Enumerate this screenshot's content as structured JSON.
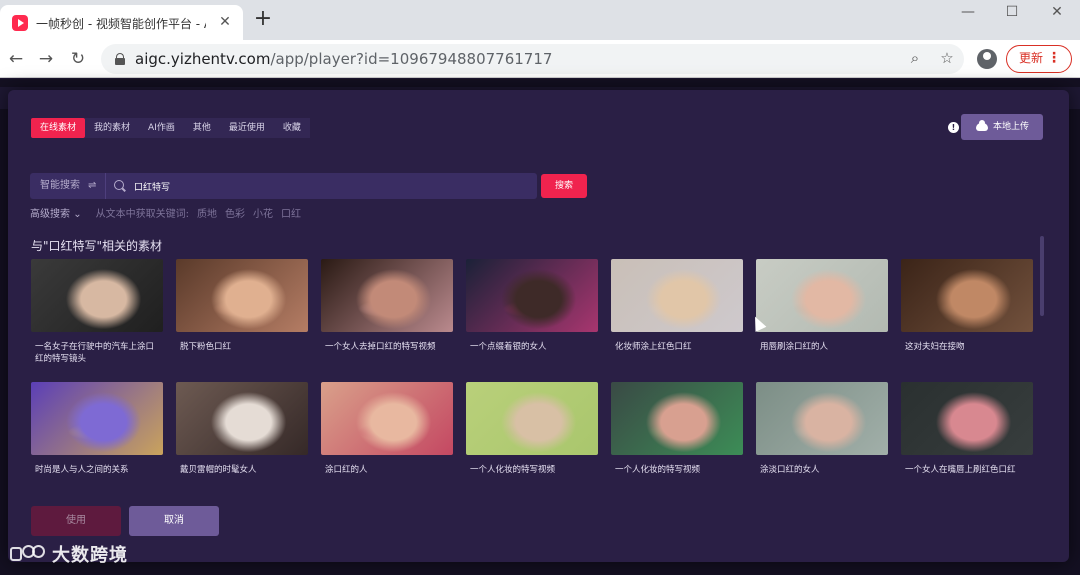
{
  "browser": {
    "tab_title": "一帧秒创 - 视频智能创作平台 - A",
    "url_host": "aigc.yizhentv.com",
    "url_path": "/app/player?id=10967948807761717",
    "update_label": "更新"
  },
  "modal": {
    "tabs": [
      {
        "label": "在线素材",
        "active": true
      },
      {
        "label": "我的素材",
        "active": false
      },
      {
        "label": "AI作画",
        "active": false
      },
      {
        "label": "其他",
        "active": false
      },
      {
        "label": "最近使用",
        "active": false
      },
      {
        "label": "收藏",
        "active": false
      }
    ],
    "upload_label": "本地上传",
    "search": {
      "mode_label": "智能搜索",
      "value": "口红特写",
      "button_label": "搜索"
    },
    "advanced": {
      "label": "高级搜索",
      "hint": "从文本中获取关键词:",
      "keywords": [
        "质地",
        "色彩",
        "小花",
        "口红"
      ]
    },
    "section_title": "与\"口红特写\"相关的素材",
    "items": [
      {
        "caption": "一名女子在行驶中的汽车上涂口红的特写镜头",
        "colors": [
          "#3a3a3a",
          "#d7b8a2",
          "#1a1a1a"
        ]
      },
      {
        "caption": "脱下粉色口红",
        "colors": [
          "#5a3a2a",
          "#e0b090",
          "#c78a70"
        ]
      },
      {
        "caption": "一个女人去掉口红的特写视频",
        "colors": [
          "#2a1a14",
          "#c28a78",
          "#d7a0a6"
        ]
      },
      {
        "caption": "一个点缀着银的女人",
        "colors": [
          "#1b2138",
          "#3e2a28",
          "#c43a7a"
        ]
      },
      {
        "caption": "化妆师涂上红色口红",
        "colors": [
          "#c9bfb7",
          "#e1c6a8",
          "#cfcbd1"
        ]
      },
      {
        "caption": "用唇刷涂口红的人",
        "colors": [
          "#c8ccc4",
          "#e2b8a4",
          "#aeb6ae"
        ]
      },
      {
        "caption": "这对夫妇在接吻",
        "colors": [
          "#3b2418",
          "#c08865",
          "#7d5a44"
        ]
      },
      {
        "caption": "时尚是人与人之间的关系",
        "colors": [
          "#5b3fb7",
          "#7e6ad4",
          "#e0b74a"
        ]
      },
      {
        "caption": "戴贝雷帽的时髦女人",
        "colors": [
          "#6d5a52",
          "#e5dcd5",
          "#2a1f1f"
        ]
      },
      {
        "caption": "涂口红的人",
        "colors": [
          "#d9a08a",
          "#e8b8a0",
          "#c0365a"
        ]
      },
      {
        "caption": "一个人化妆的特写视频",
        "colors": [
          "#b9d07a",
          "#d8c0a5",
          "#a6c46a"
        ]
      },
      {
        "caption": "一个人化妆的特写视频",
        "colors": [
          "#3a4a45",
          "#d8a090",
          "#3d9a5a"
        ]
      },
      {
        "caption": "涂淡口红的女人",
        "colors": [
          "#7c8e86",
          "#d9b3a2",
          "#a9b6b0"
        ]
      },
      {
        "caption": "一个女人在嘴唇上刷红色口红",
        "colors": [
          "#2a3030",
          "#d88890",
          "#3a4040"
        ]
      }
    ],
    "use_label": "使用",
    "cancel_label": "取消"
  },
  "watermark": {
    "text": "大数跨境"
  }
}
